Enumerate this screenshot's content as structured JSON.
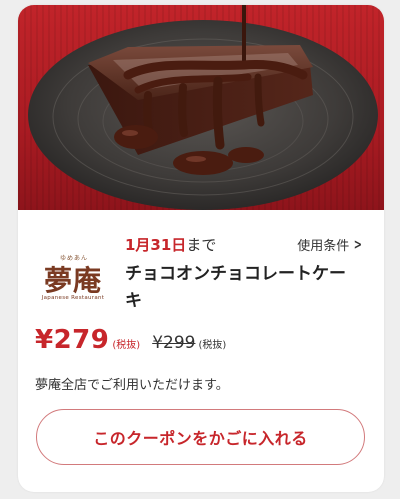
{
  "coupon": {
    "image_alt": "チョコオンチョコレートケーキ",
    "brand": {
      "name": "夢庵",
      "ruby": "ゆめあん",
      "sub": "Japanese Restaurant"
    },
    "deadline": {
      "date": "1月31日",
      "suffix": "まで"
    },
    "terms_label": "使用条件",
    "title": "チョコオンチョコレートケーキ",
    "price": "¥279",
    "price_tax": "(税抜)",
    "original_price": "¥299",
    "original_tax": "(税抜)",
    "note": "夢庵全店でご利用いただけます。",
    "cta_label": "このクーポンをかごに入れる"
  },
  "colors": {
    "accent": "#c7262b",
    "button_border": "#d27a7c",
    "background": "#eeeeee"
  },
  "icons": {
    "terms_chevron": "chevron-right-icon"
  }
}
